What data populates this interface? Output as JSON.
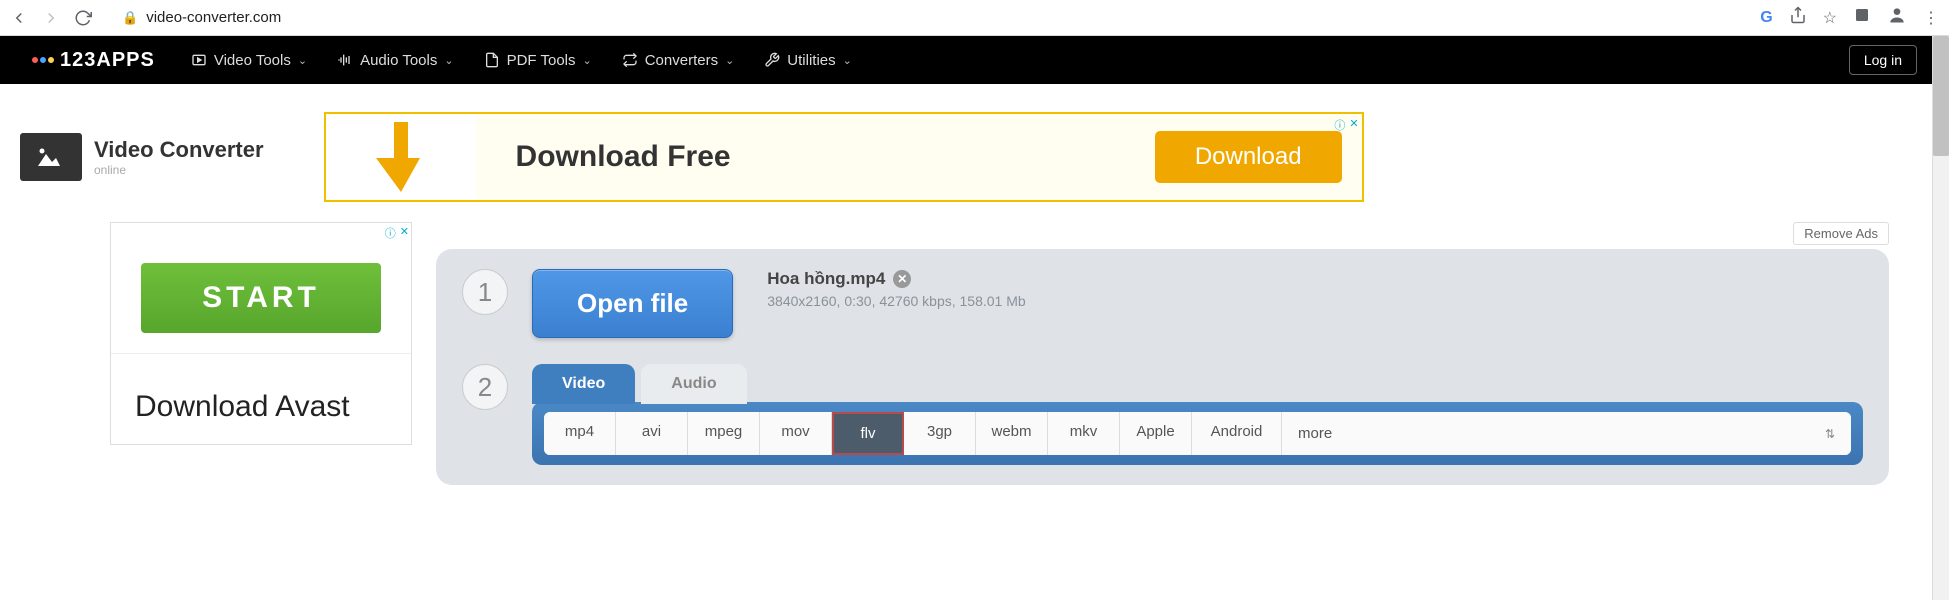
{
  "browser": {
    "url": "video-converter.com"
  },
  "header": {
    "logo": "123APPS",
    "menu": [
      {
        "label": "Video Tools"
      },
      {
        "label": "Audio Tools"
      },
      {
        "label": "PDF Tools"
      },
      {
        "label": "Converters"
      },
      {
        "label": "Utilities"
      }
    ],
    "login": "Log in"
  },
  "brand": {
    "title": "Video Converter",
    "subtitle": "online"
  },
  "top_ad": {
    "headline": "Download Free",
    "cta": "Download"
  },
  "side_ad": {
    "cta": "START",
    "text": "Download Avast"
  },
  "remove_ads": "Remove Ads",
  "step1": {
    "num": "1",
    "button": "Open file",
    "filename": "Hoa hồng.mp4",
    "meta": "3840x2160, 0:30, 42760 kbps, 158.01 Mb"
  },
  "step2": {
    "num": "2",
    "tabs": {
      "video": "Video",
      "audio": "Audio"
    },
    "formats": [
      "mp4",
      "avi",
      "mpeg",
      "mov",
      "flv",
      "3gp",
      "webm",
      "mkv",
      "Apple",
      "Android",
      "more"
    ],
    "selected": "flv"
  }
}
